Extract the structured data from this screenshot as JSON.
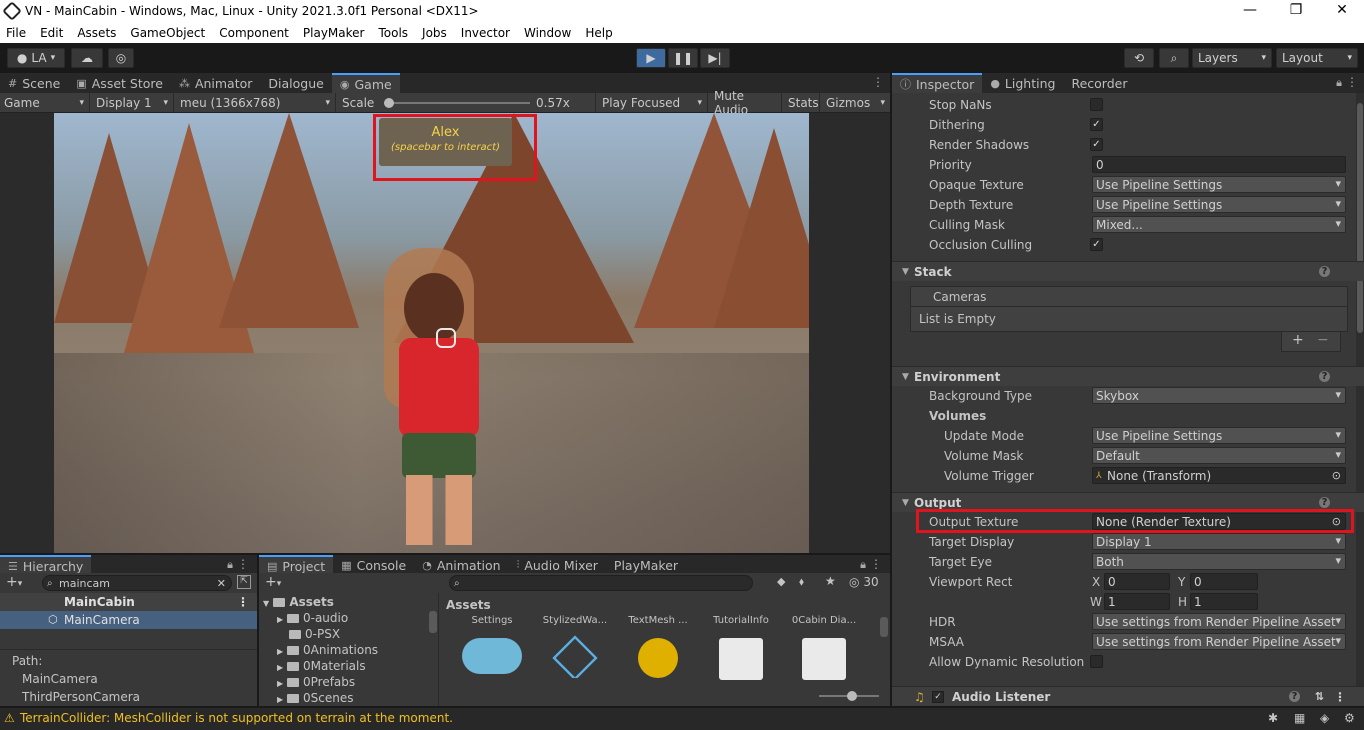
{
  "window": {
    "title": "VN - MainCabin - Windows, Mac, Linux - Unity 2021.3.0f1 Personal <DX11>",
    "minimize": "—",
    "maximize": "❐",
    "close": "✕"
  },
  "menu": [
    "File",
    "Edit",
    "Assets",
    "GameObject",
    "Component",
    "PlayMaker",
    "Tools",
    "Jobs",
    "Invector",
    "Window",
    "Help"
  ],
  "toolbar": {
    "account": "LA",
    "layers": "Layers",
    "layout": "Layout"
  },
  "left_tabs": [
    {
      "label": "Scene",
      "icon": "#"
    },
    {
      "label": "Asset Store",
      "icon": "▣"
    },
    {
      "label": "Animator",
      "icon": "⁂"
    },
    {
      "label": "Dialogue",
      "icon": ""
    },
    {
      "label": "Game",
      "icon": "◉"
    }
  ],
  "game_bar": {
    "view": "Game",
    "display": "Display 1",
    "resolution": "meu (1366x768)",
    "scale_label": "Scale",
    "scale_value": "0.57x",
    "scale_fraction": 0.57,
    "play_focused": "Play Focused",
    "mute": "Mute Audio",
    "stats": "Stats",
    "gizmos": "Gizmos"
  },
  "dialog": {
    "name": "Alex",
    "hint": "(spacebar to interact)"
  },
  "right_tabs": [
    {
      "label": "Inspector",
      "icon": "ⓘ"
    },
    {
      "label": "Lighting",
      "icon": "●"
    },
    {
      "label": "Recorder",
      "icon": ""
    }
  ],
  "inspector": {
    "rows_top": [
      {
        "label": "Stop NaNs",
        "type": "check",
        "value": ""
      },
      {
        "label": "Dithering",
        "type": "check",
        "value": "✓"
      },
      {
        "label": "Render Shadows",
        "type": "check",
        "value": "✓"
      },
      {
        "label": "Priority",
        "type": "text",
        "value": "0"
      },
      {
        "label": "Opaque Texture",
        "type": "dd",
        "value": "Use Pipeline Settings"
      },
      {
        "label": "Depth Texture",
        "type": "dd",
        "value": "Use Pipeline Settings"
      },
      {
        "label": "Culling Mask",
        "type": "dd",
        "value": "Mixed..."
      },
      {
        "label": "Occlusion Culling",
        "type": "check",
        "value": "✓"
      }
    ],
    "stack": {
      "title": "Stack",
      "cameras": "Cameras",
      "empty": "List is Empty",
      "plus": "+",
      "minus": "−"
    },
    "environment": {
      "title": "Environment",
      "bg_label": "Background Type",
      "bg_value": "Skybox",
      "volumes": "Volumes",
      "rows": [
        {
          "label": "Update Mode",
          "value": "Use Pipeline Settings"
        },
        {
          "label": "Volume Mask",
          "value": "Default"
        },
        {
          "label": "Volume Trigger",
          "value": "None (Transform)"
        }
      ]
    },
    "output": {
      "title": "Output",
      "texture_label": "Output Texture",
      "texture_value": "None (Render Texture)",
      "display_label": "Target Display",
      "display_value": "Display 1",
      "eye_label": "Target Eye",
      "eye_value": "Both",
      "viewport_label": "Viewport Rect",
      "x_label": "X",
      "x": "0",
      "y_label": "Y",
      "y": "0",
      "w_label": "W",
      "w": "1",
      "h_label": "H",
      "h": "1",
      "hdr_label": "HDR",
      "hdr_value": "Use settings from Render Pipeline Asset",
      "msaa_label": "MSAA",
      "msaa_value": "Use settings from Render Pipeline Asset",
      "adr_label": "Allow Dynamic Resolution"
    },
    "audio_listener": "Audio Listener"
  },
  "hierarchy": {
    "tab": "Hierarchy",
    "search": "maincam",
    "items": [
      "MainCabin",
      "MainCamera"
    ],
    "path_label": "Path:",
    "paths": [
      "MainCamera",
      "ThirdPersonCamera"
    ]
  },
  "bottom_tabs": [
    {
      "label": "Project",
      "icon": "▤"
    },
    {
      "label": "Console",
      "icon": "▦"
    },
    {
      "label": "Animation",
      "icon": "◔"
    },
    {
      "label": "Audio Mixer",
      "icon": "⫶"
    },
    {
      "label": "PlayMaker",
      "icon": ""
    }
  ],
  "project": {
    "root": "Assets",
    "folders": [
      "0-audio",
      "0-PSX",
      "0Animations",
      "0Materials",
      "0Prefabs",
      "0Scenes"
    ],
    "breadcrumb": "Assets",
    "assets": [
      "Settings",
      "StylizedWa...",
      "TextMesh ...",
      "TutorialInfo",
      "0Cabin Dia..."
    ],
    "count": "30"
  },
  "status": {
    "message": "TerrainCollider: MeshCollider is not supported on terrain at the moment."
  },
  "colors": {
    "accent": "#4a9eff",
    "highlight": "#e0141e",
    "warning": "#f0c020",
    "dialog_text": "#f4d24a"
  }
}
